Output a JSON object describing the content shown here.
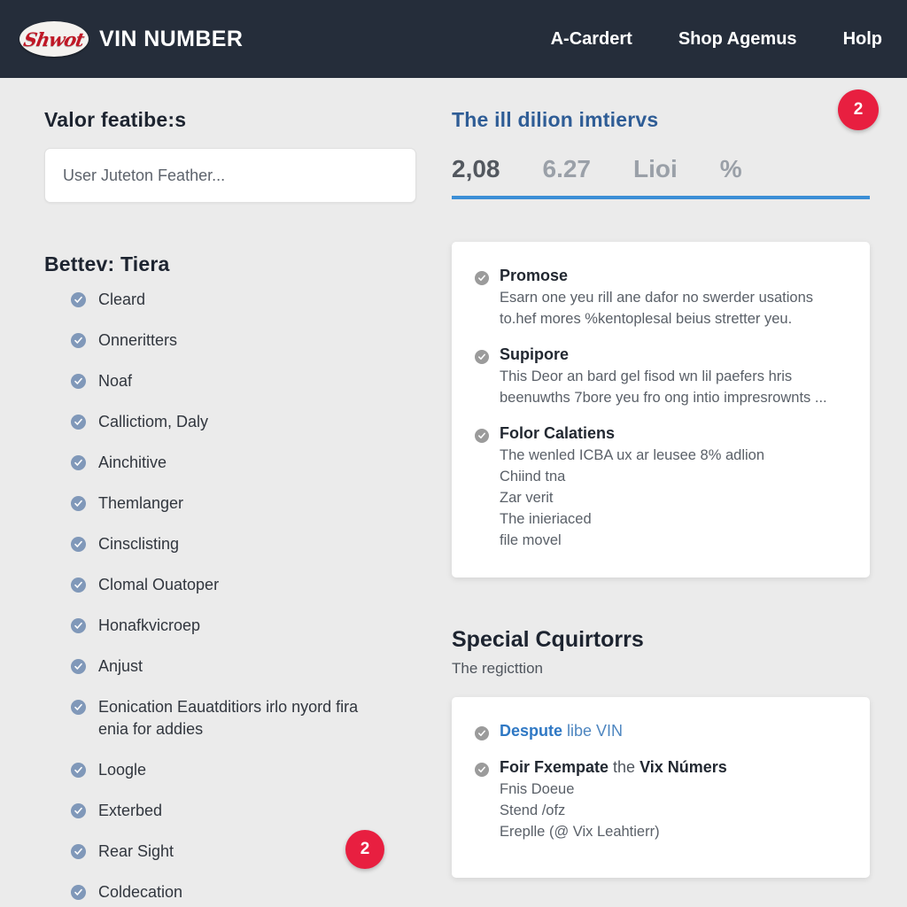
{
  "header": {
    "logo_text": "Shwot",
    "logo_icon": "oval-script-logo",
    "title": "VIN NUMBER",
    "nav": [
      {
        "label": "A-Cardert"
      },
      {
        "label": "Shop Agemus"
      },
      {
        "label": "Holp"
      }
    ]
  },
  "badges": {
    "top_right": "2",
    "left_column": "2"
  },
  "left": {
    "heading": "Valor featibe:s",
    "search_placeholder": "User Juteton Feather...",
    "search_value": "",
    "list_heading": "Bettev: Tiera",
    "items": [
      {
        "label": "Cleard"
      },
      {
        "label": "Onneritters"
      },
      {
        "label": "Noaf"
      },
      {
        "label": "Callictiom, Daly"
      },
      {
        "label": "Ainchitive"
      },
      {
        "label": "Themlanger"
      },
      {
        "label": "Cinsclisting"
      },
      {
        "label": "Clomal Ouatoper"
      },
      {
        "label": "Honafkvicroep"
      },
      {
        "label": "Anjust"
      },
      {
        "label": "Eonication Eauatditiors irlo nyord fira enia for addies"
      },
      {
        "label": "Loogle"
      },
      {
        "label": "Exterbed"
      },
      {
        "label": "Rear Sight"
      },
      {
        "label": "Coldecation"
      }
    ]
  },
  "right": {
    "panel_heading": "The ill dilion imtiervs",
    "stats": [
      {
        "label": "2,08",
        "active": true
      },
      {
        "label": "6.27",
        "active": false
      },
      {
        "label": "Lioi",
        "active": false
      },
      {
        "label": "%",
        "active": false
      }
    ],
    "info_card": [
      {
        "title": "Promose",
        "body": "Esarn one yeu rill ane dafor no swerder usations to.hef mores %kentoplesal beius stretter yeu."
      },
      {
        "title": "Supipore",
        "body": "This Deor an bard gel fisod wn lil paefers hris beenuwths 7bore yeu fro ong intio impresrownts ..."
      },
      {
        "title": "Folor Calatiens",
        "body": "The wenled ICBA ux ar leusee 8% adlion\nChiind tna\nZar verit\nThe inieriaced\nfile movel"
      }
    ],
    "special_heading": "Special Cquirtorrs",
    "special_sub": "The regicttion",
    "special_card": [
      {
        "title_bold": "Despute",
        "title_rest": " libe VIN",
        "body": "",
        "is_link": true
      },
      {
        "title_bold": "Foir Fxempate",
        "title_mid": " the ",
        "title_tail": "Vix Númers",
        "body": "Fnis Doeue\nStend /ofz\nEreplle (@ Vix Leahtierr)",
        "is_link": false
      }
    ]
  },
  "colors": {
    "header_bg": "#252d3a",
    "page_bg": "#ebebeb",
    "accent_blue": "#3b8ed6",
    "heading_blue": "#2f5d96",
    "badge_red": "#e81f40",
    "check_blue": "#8098b9",
    "check_gray": "#9b9b9b",
    "logo_red": "#c01826"
  }
}
